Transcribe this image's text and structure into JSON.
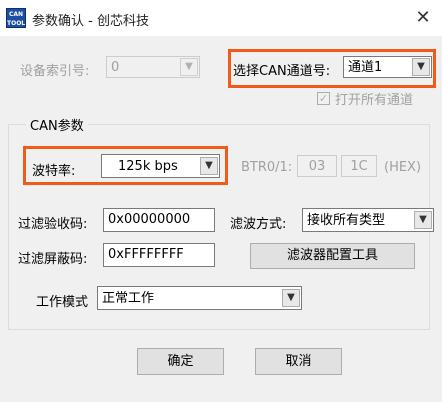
{
  "window": {
    "title": "参数确认 - 创芯科技",
    "app_icon_text": "CAN TOOL",
    "close_glyph": "✕"
  },
  "device": {
    "label": "设备索引号:",
    "value": "0"
  },
  "channel": {
    "label": "选择CAN通道号:",
    "value": "通道1",
    "open_all_label": "打开所有通道",
    "open_all_checked": true
  },
  "can_group": {
    "title": "CAN参数",
    "baud_label": "波特率:",
    "baud_value": "125k bps",
    "btr_label": "BTR0/1:",
    "btr0": "03",
    "btr1": "1C",
    "hex_label": "(HEX)",
    "acc_code_label": "过滤验收码:",
    "acc_code": "0x00000000",
    "filter_mode_label": "滤波方式:",
    "filter_mode": "接收所有类型",
    "mask_label": "过滤屏蔽码:",
    "mask_value": "0xFFFFFFFF",
    "filter_tool_button": "滤波器配置工具",
    "work_mode_label": "工作模式",
    "work_mode": "正常工作"
  },
  "buttons": {
    "ok": "确定",
    "cancel": "取消"
  },
  "colors": {
    "highlight": "#f25a1c",
    "window_bg": "#f0f0f0"
  },
  "icons": {
    "dropdown": "chevron-down-icon",
    "checkbox": "checkmark-icon",
    "close": "close-icon"
  }
}
